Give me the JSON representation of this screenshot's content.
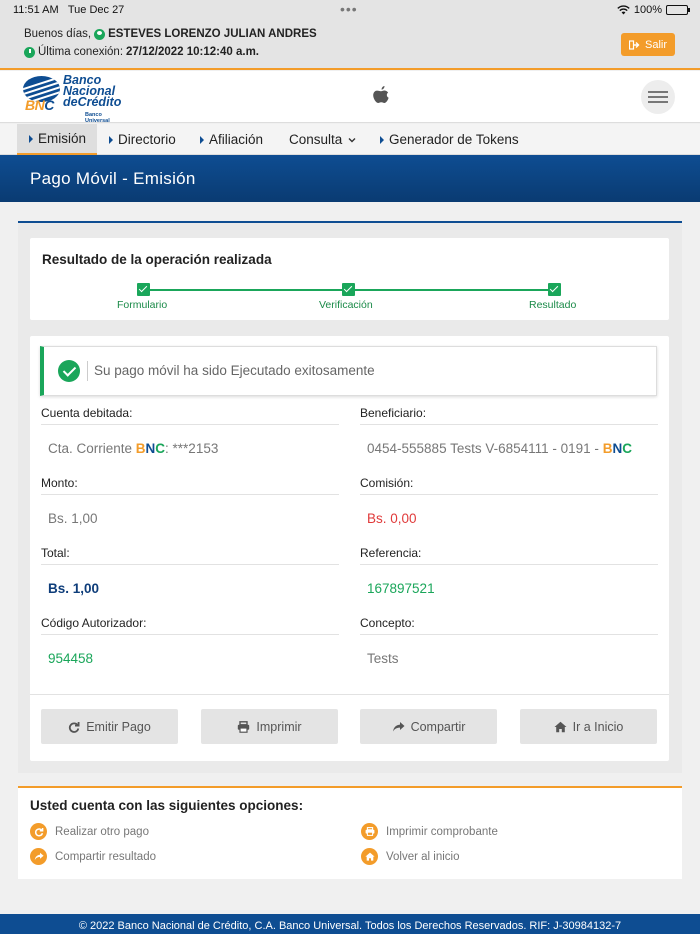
{
  "status_bar": {
    "time": "11:51 AM",
    "date": "Tue Dec 27",
    "battery": "100%"
  },
  "greeting": {
    "hello": "Buenos días,",
    "user_name": "ESTEVES LORENZO JULIAN ANDRES",
    "last_login_label": "Última conexión:",
    "last_login_value": "27/12/2022 10:12:40 a.m.",
    "logout_label": "Salir"
  },
  "brand": {
    "line1": "Banco",
    "line2": "Nacional",
    "line3": "deCrédito",
    "sub": "Banco Universal",
    "short": "BNC"
  },
  "nav": {
    "items": [
      {
        "label": "Emisión"
      },
      {
        "label": "Directorio"
      },
      {
        "label": "Afiliación"
      },
      {
        "label": "Consulta"
      },
      {
        "label": "Generador de Tokens"
      }
    ]
  },
  "page_title": "Pago Móvil - Emisión",
  "steps": {
    "heading": "Resultado de la operación realizada",
    "items": [
      "Formulario",
      "Verificación",
      "Resultado"
    ]
  },
  "result": {
    "success_message": "Su pago móvil ha sido Ejecutado exitosamente",
    "fields": {
      "debit_label": "Cuenta debitada:",
      "debit_prefix": "Cta. Corriente ",
      "debit_suffix": ": ***2153",
      "beneficiary_label": "Beneficiario:",
      "beneficiary_value": "0454-555885 Tests V-6854111 - 0191 - ",
      "amount_label": "Monto:",
      "amount_value": "Bs. 1,00",
      "commission_label": "Comisión:",
      "commission_value": "Bs. 0,00",
      "total_label": "Total:",
      "total_value": "Bs. 1,00",
      "reference_label": "Referencia:",
      "reference_value": "167897521",
      "auth_code_label": "Código Autorizador:",
      "auth_code_value": "954458",
      "concept_label": "Concepto:",
      "concept_value": "Tests"
    },
    "buttons": {
      "emit": "Emitir Pago",
      "print": "Imprimir",
      "share": "Compartir",
      "home": "Ir a Inicio"
    }
  },
  "options": {
    "heading": "Usted cuenta con las siguientes opciones:",
    "items": [
      "Realizar otro pago",
      "Imprimir comprobante",
      "Compartir resultado",
      "Volver al inicio"
    ]
  },
  "footer": "© 2022 Banco Nacional de Crédito, C.A. Banco Universal.  Todos los Derechos Reservados. RIF: J-30984132-7"
}
